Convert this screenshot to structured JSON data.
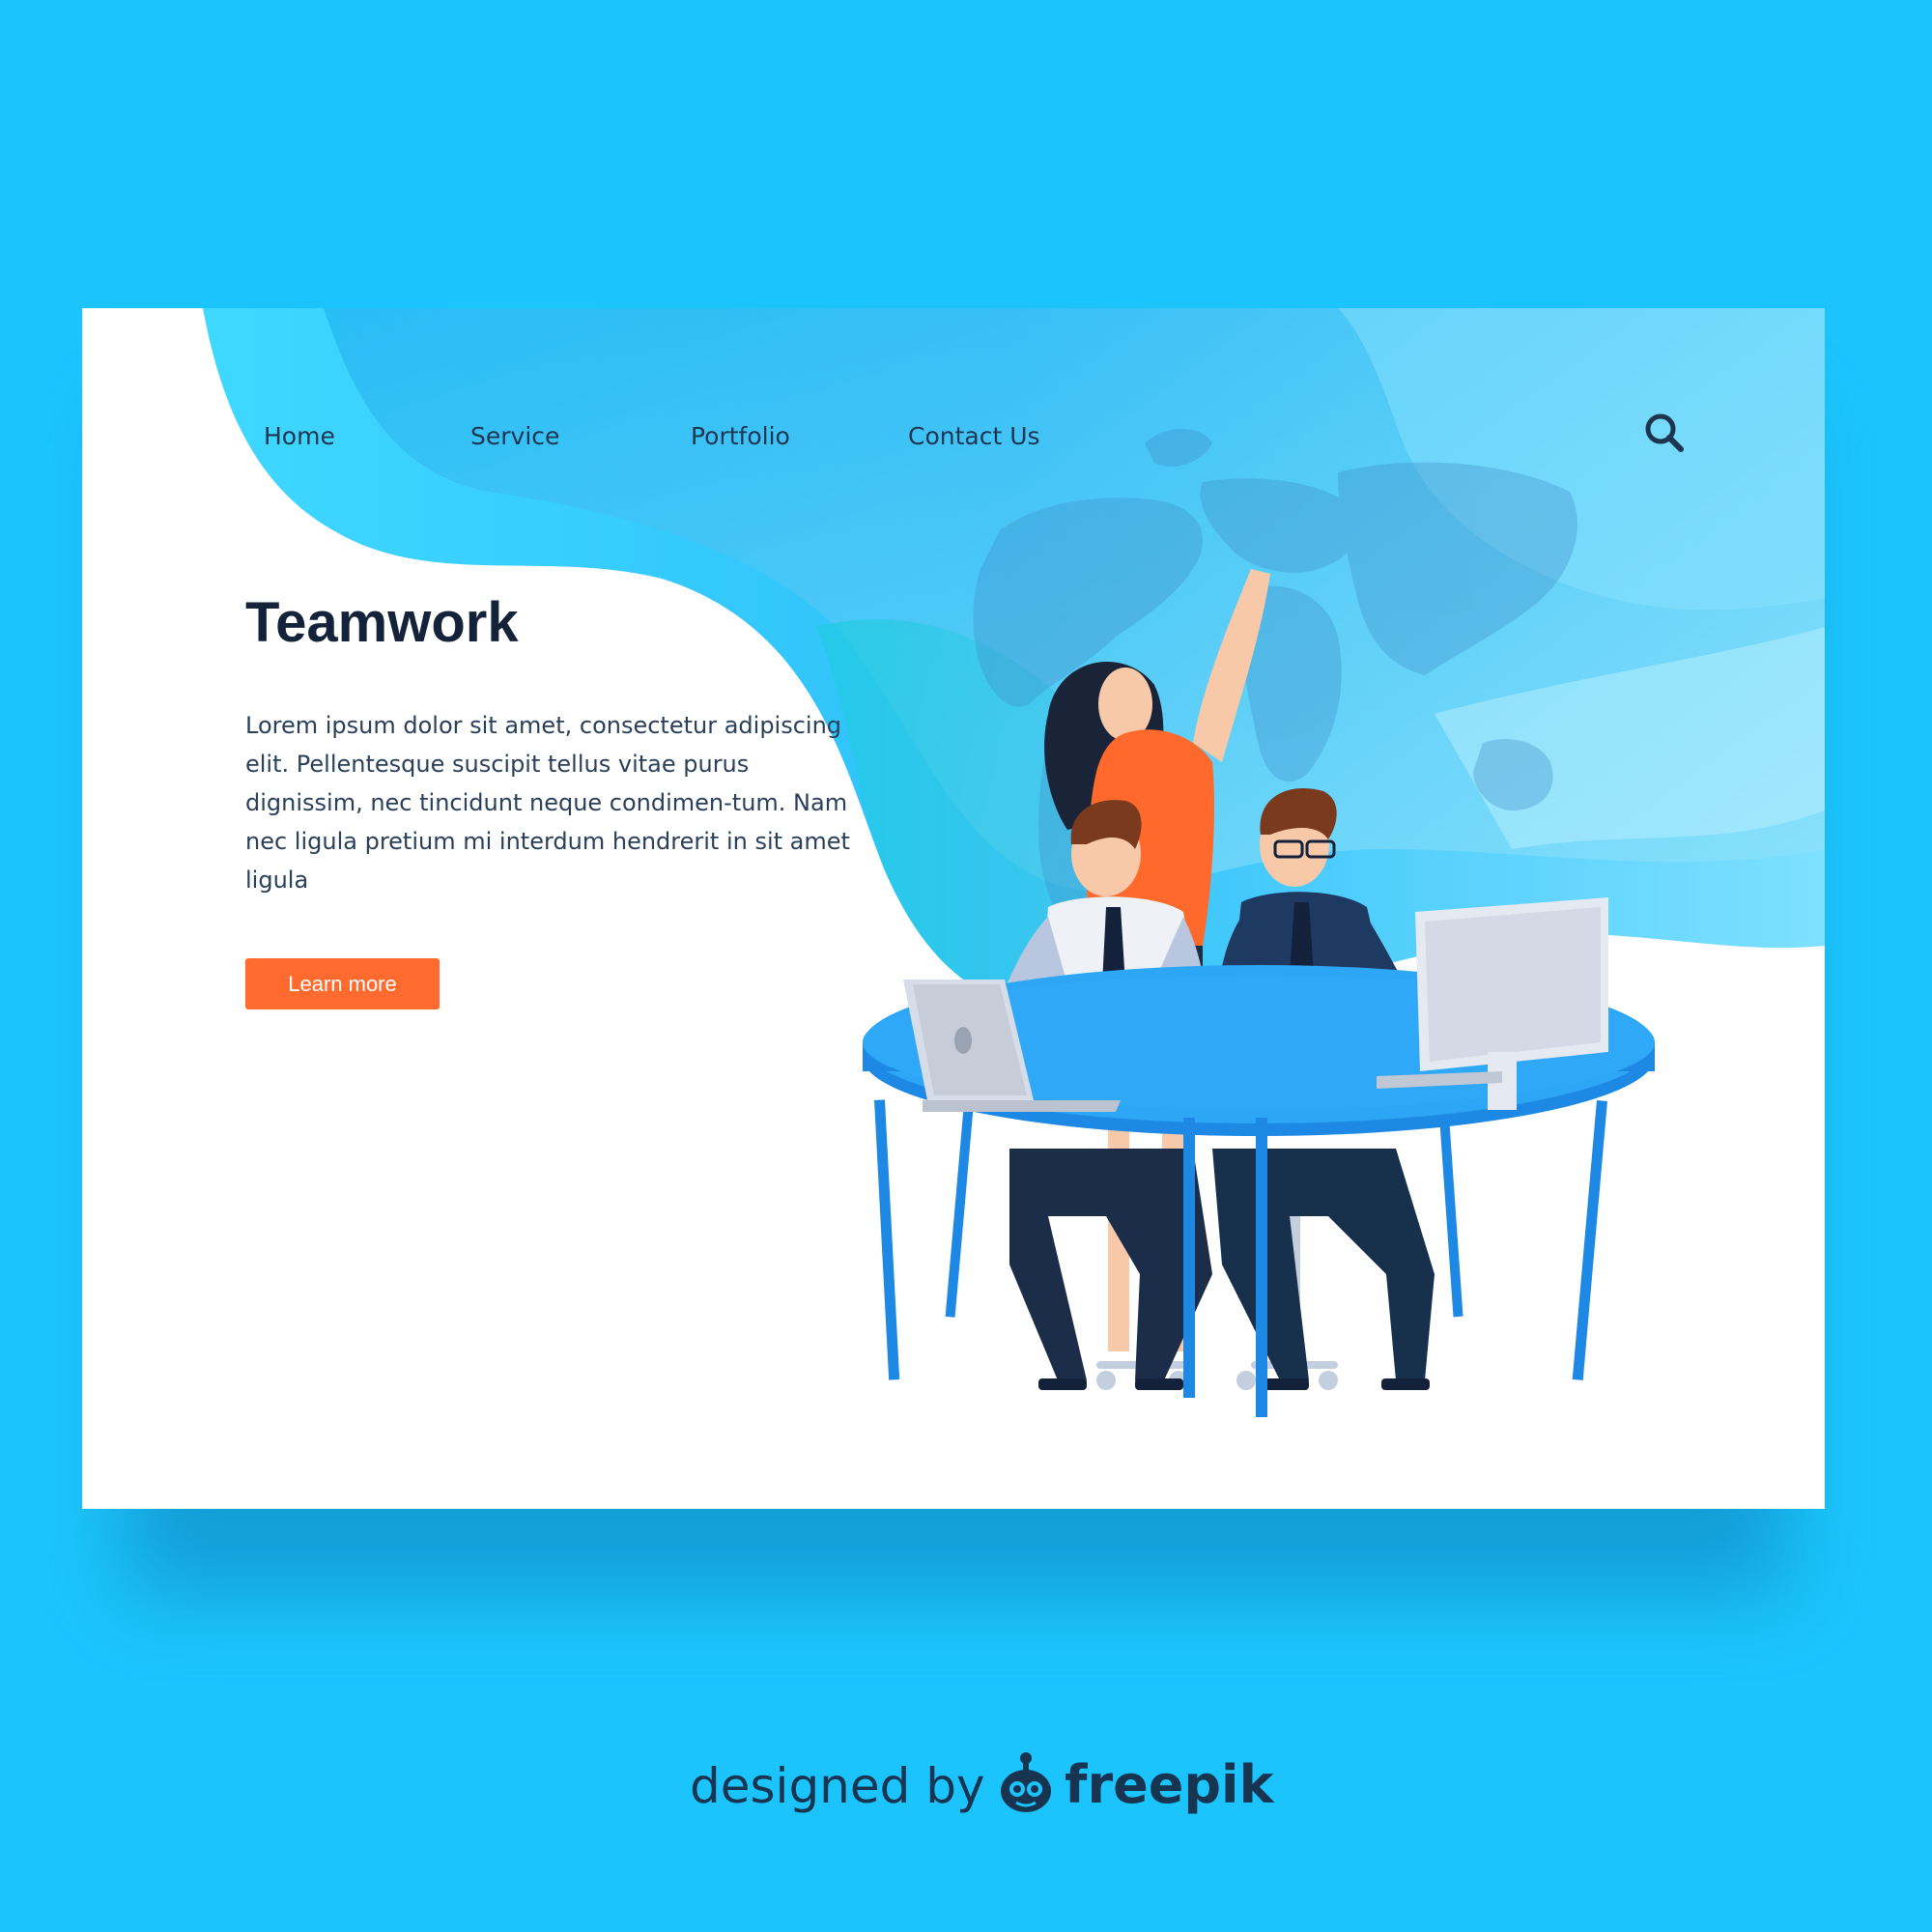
{
  "nav": {
    "items": [
      {
        "label": "Home"
      },
      {
        "label": "Service"
      },
      {
        "label": "Portfolio"
      },
      {
        "label": "Contact Us"
      }
    ],
    "search_icon": "magnifier-icon"
  },
  "hero": {
    "title": "Teamwork",
    "body": "Lorem ipsum dolor sit amet, consectetur adipiscing elit. Pellentesque suscipit tellus vitae purus dignissim, nec tincidunt neque condimen-tum. Nam nec ligula pretium mi interdum hendrerit in sit amet ligula",
    "cta_label": "Learn more"
  },
  "credit": {
    "prefix": "designed by",
    "brand": "freepik",
    "logo_icon": "freepik-robot-icon"
  },
  "colors": {
    "page_background": "#1BC4FD",
    "accent_button": "#FF6B2F",
    "heading_text": "#14233A",
    "table_blue": "#2196F3"
  },
  "illustration": {
    "subject": "team-at-desk-world-map-icon"
  }
}
